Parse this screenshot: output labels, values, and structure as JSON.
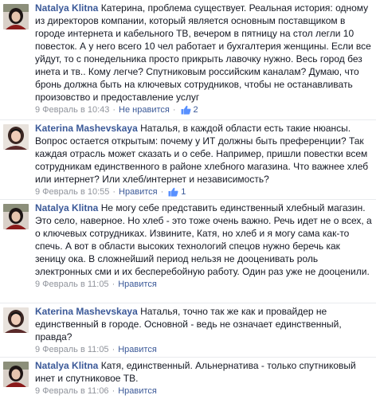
{
  "comments": [
    {
      "author": "Natalya Klitna",
      "text": "Катерина, проблема существует. Реальная история: одному из директоров компании, который является основным поставщиком в городе интернета и кабельного ТВ, вечером в пятницу на стол легли 10 повесток. А у него всего 10 чел работает и бухгалтерия женщины. Если все уйдут, то с понедельника просто прикрыть лавочку нужно. Весь город без инета и тв.. Кому легче? Спутниковым российским каналам? Думаю, что бронь должна быть на ключевых сотрудников, чтобы не останавливать произовство и предоставление услуг",
      "time": "9 Февраль в 10:43",
      "action": "Не нравится",
      "likes": "2",
      "avatar_icon": "profile-photo-natalya"
    },
    {
      "author": "Katerina Mashevskaya",
      "text": "Наталья, в каждой области есть такие нюансы. Вопрос остается открытым: почему у ИТ должны быть преференции? Так каждая отрасль может сказать и о себе. Например, пришли повестки всем сотрудникам единственного в районе хлебного магазина. Что важнее хлеб или интернет? Или хлеб/интернет и независимость?",
      "time": "9 Февраль в 10:55",
      "action": "Нравится",
      "likes": "1",
      "avatar_icon": "profile-photo-katerina"
    },
    {
      "author": "Natalya Klitna",
      "text": "Не могу себе представить единственный хлебный магазин. Это село, наверное. Но хлеб - это тоже очень важно. Речь идет не о всех, а о ключевых сотрудниках. Извините, Катя, но хлеб и я могу сама как-то спечь. А вот в области высоких технологий спецов нужно беречь как зеницу ока. В сложнейший период нельзя не дооценивать роль электронных сми и их бесперебойную работу. Один раз уже не дооценили.",
      "time": "9 Февраль в 11:05",
      "action": "Нравится",
      "likes": "",
      "avatar_icon": "profile-photo-natalya"
    },
    {
      "author": "Katerina Mashevskaya",
      "text": "Наталья, точно так же как и провайдер не единственный в городе. Основной - ведь не означает единственный, правда?",
      "time": "9 Февраль в 11:05",
      "action": "Нравится",
      "likes": "",
      "avatar_icon": "profile-photo-katerina"
    },
    {
      "author": "Natalya Klitna",
      "text": "Катя, единственный. Альнернатива - только спутниковый инет и спутниковое ТВ.",
      "time": "9 Февраль в 11:06",
      "action": "Нравится",
      "likes": "",
      "avatar_icon": "profile-photo-natalya"
    }
  ],
  "separator": "·",
  "colors": {
    "link": "#3b5998",
    "meta": "#90949c",
    "text": "#141823"
  }
}
